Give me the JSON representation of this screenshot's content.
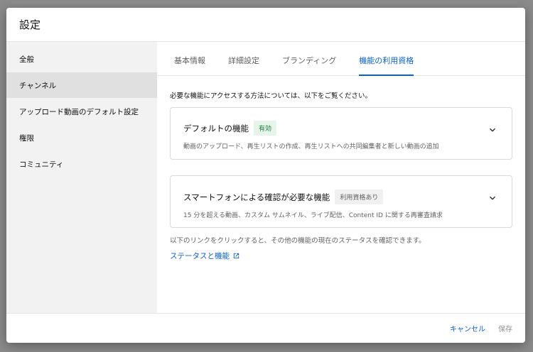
{
  "dialog": {
    "title": "設定"
  },
  "sidebar": {
    "items": [
      {
        "label": "全般"
      },
      {
        "label": "チャンネル"
      },
      {
        "label": "アップロード動画のデフォルト設定"
      },
      {
        "label": "権限"
      },
      {
        "label": "コミュニティ"
      }
    ],
    "active_index": 1
  },
  "tabs": [
    {
      "label": "基本情報"
    },
    {
      "label": "詳細設定"
    },
    {
      "label": "ブランディング"
    },
    {
      "label": "機能の利用資格"
    }
  ],
  "active_tab_index": 3,
  "content": {
    "intro": "必要な機能にアクセスする方法については、以下をご覧ください。",
    "cards": [
      {
        "title": "デフォルトの機能",
        "badge": "有効",
        "description": "動画のアップロード、再生リストの作成、再生リストへの共同編集者と新しい動画の追加"
      },
      {
        "title": "スマートフォンによる確認が必要な機能",
        "badge": "利用資格あり",
        "description": "15 分を超える動画、カスタム サムネイル、ライブ配信、Content ID に関する再審査請求"
      }
    ],
    "footer_note": "以下のリンクをクリックすると、その他の機能の現在のステータスを確認できます。",
    "link_label": "ステータスと機能"
  },
  "footer": {
    "cancel_label": "キャンセル",
    "save_label": "保存"
  },
  "colors": {
    "accent": "#065fd4",
    "badge_green_bg": "#e6f4ea",
    "badge_green_text": "#188038"
  },
  "icons": {
    "card_expand": "chevron-down-icon",
    "link_external": "external-link-icon"
  }
}
